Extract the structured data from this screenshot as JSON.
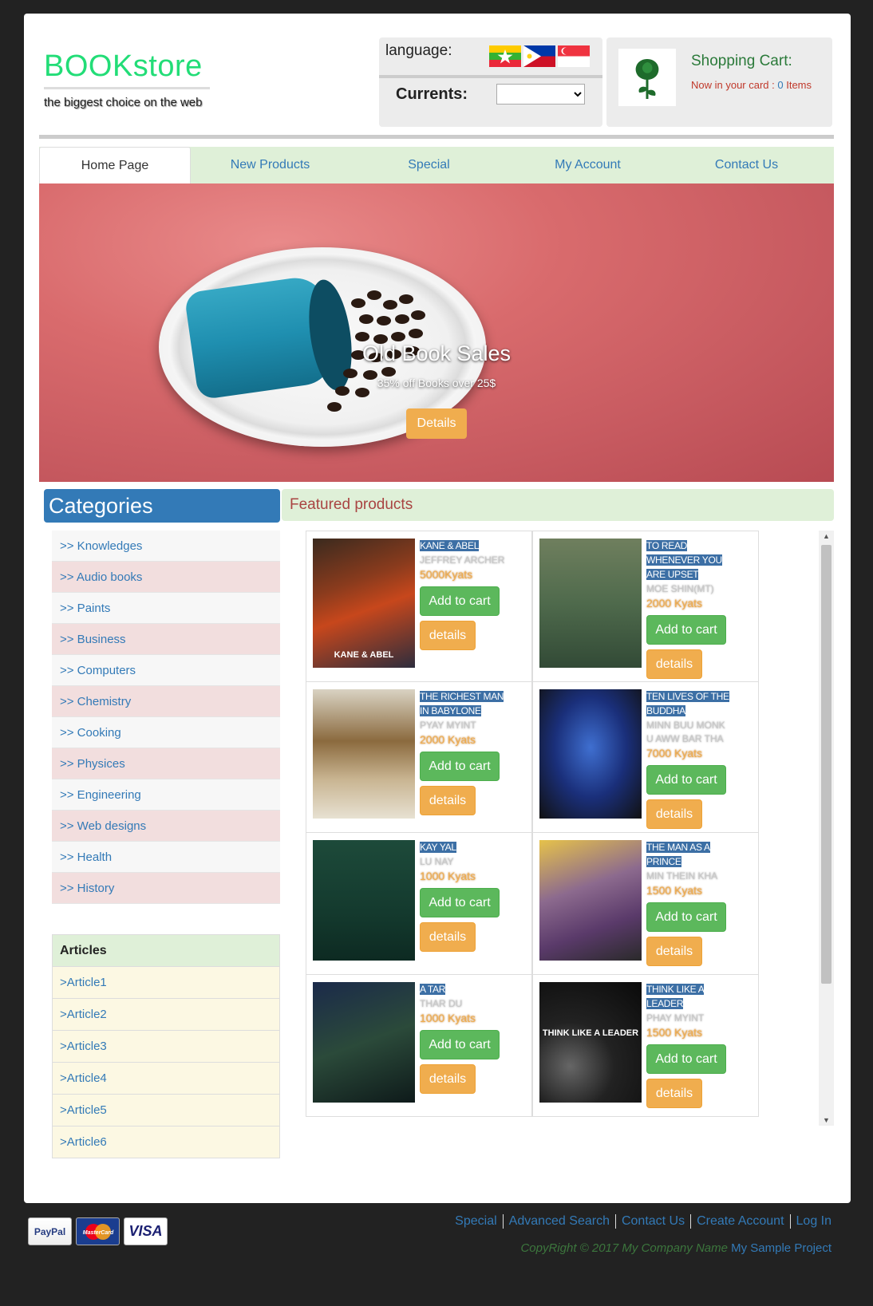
{
  "header": {
    "logo_title": "BOOKstore",
    "logo_tagline": "the biggest choice on the web",
    "language_label": "language:",
    "flags": [
      "myanmar-flag-icon",
      "philippines-flag-icon",
      "singapore-flag-icon"
    ],
    "currency_label": "Currents:",
    "currency_value": "",
    "cart_title": "Shopping Cart:",
    "cart_text": "Now in your card : ",
    "cart_count": "0",
    "cart_items_word": " Items"
  },
  "nav": {
    "items": [
      "Home Page",
      "New Products",
      "Special",
      "My Account",
      "Contact Us"
    ],
    "active": "Home Page"
  },
  "hero": {
    "caption": "Old Book Sales",
    "subcaption": "35% off Books over 25$",
    "button": "Details"
  },
  "categories": {
    "title": "Categories",
    "items": [
      ">> Knowledges",
      ">> Audio books",
      ">> Paints",
      ">> Business",
      ">> Computers",
      ">> Chemistry",
      ">> Cooking",
      ">> Physices",
      ">> Engineering",
      ">> Web designs",
      ">> Health",
      ">> History"
    ]
  },
  "articles": {
    "title": "Articles",
    "items": [
      ">Article1",
      ">Article2",
      ">Article3",
      ">Article4",
      ">Article5",
      ">Article6"
    ]
  },
  "featured": {
    "title": "Featured products",
    "add_label": "Add to cart",
    "details_label": "details",
    "products": [
      {
        "title": "KANE & ABEL",
        "author": "JEFFREY ARCHER",
        "price": "5000Kyats",
        "cover_text": "KANE & ABEL"
      },
      {
        "title": "TO READ WHENEVER YOU ARE UPSET",
        "author": "MOE SHIN(MT)",
        "price": "2000 Kyats",
        "cover_text": ""
      },
      {
        "title": "THE RICHEST MAN IN BABYLONE",
        "author": "PYAY MYINT",
        "price": "2000 Kyats",
        "cover_text": ""
      },
      {
        "title": "TEN LIVES OF THE BUDDHA",
        "author": "MINN BUU MONK U AWW BAR THA",
        "price": "7000 Kyats",
        "cover_text": ""
      },
      {
        "title": "KAY YAL",
        "author": "LU NAY",
        "price": "1000 Kyats",
        "cover_text": ""
      },
      {
        "title": "THE MAN AS A PRINCE",
        "author": "MIN THEIN KHA",
        "price": "1500 Kyats",
        "cover_text": ""
      },
      {
        "title": "A TAR",
        "author": "THAR DU",
        "price": "1000 Kyats",
        "cover_text": ""
      },
      {
        "title": "THINK LIKE A LEADER",
        "author": "PHAY MYINT",
        "price": "1500 Kyats",
        "cover_text": "THINK LIKE A LEADER"
      }
    ]
  },
  "footer": {
    "payment": [
      "PayPal",
      "MasterCard",
      "VISA"
    ],
    "links": [
      "Special",
      "Advanced Search",
      "Contact Us",
      "Create Account",
      "Log In"
    ],
    "copyright": "CopyRight © 2017 My Company Name ",
    "project": "My Sample Project"
  },
  "colors": {
    "logo": "#22dd77",
    "link": "#337ab7",
    "nav_bg": "#dff0d8",
    "category_header": "#337ab7",
    "add_button": "#5cb85c",
    "details_button": "#f0ad4e",
    "hero_bg": "#d96b6d"
  }
}
